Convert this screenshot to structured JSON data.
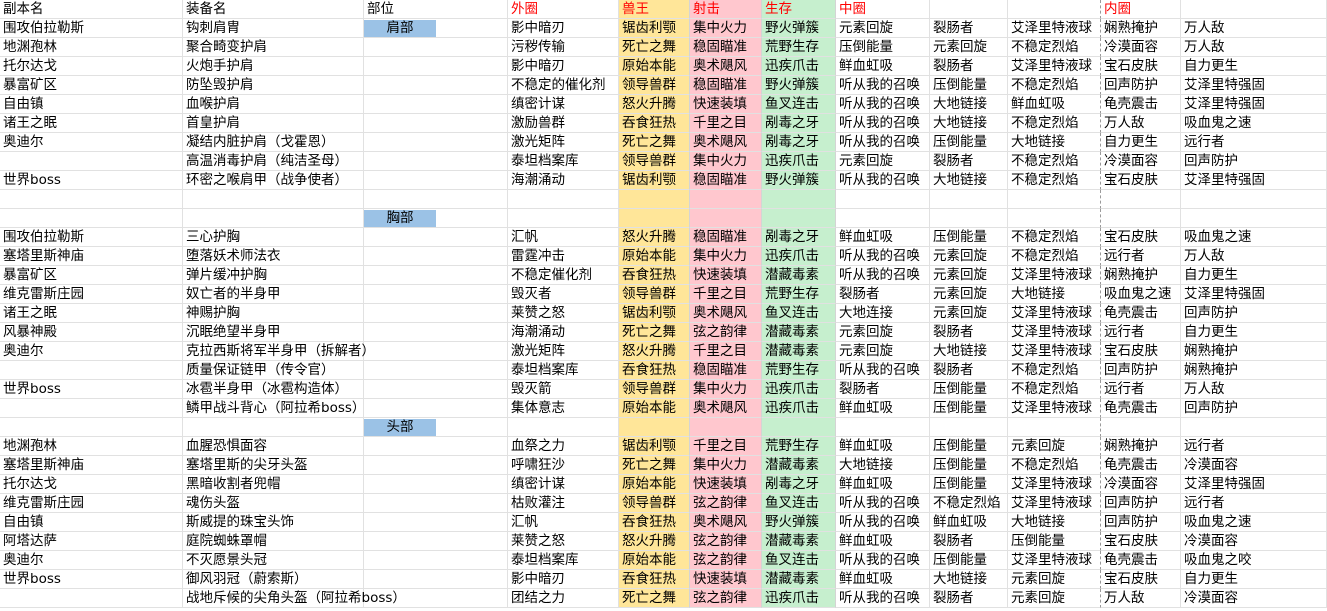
{
  "header": {
    "dungeon": "副本名",
    "equipment": "装备名",
    "slot": "部位",
    "outer": "外圈",
    "beast": "兽王",
    "marks": "射击",
    "survival": "生存",
    "middle": "中圈",
    "inner": "内圈"
  },
  "section_colors": {
    "beast": "#ffe699",
    "marks": "#ffc7ce",
    "survival": "#c6efce",
    "slot_label": "#9bc2e6",
    "header_red": "#ff0000"
  },
  "rows": [
    {
      "cells": [
        "围攻伯拉勒斯",
        "钩刺肩胄",
        "肩部",
        "影中暗刃",
        "锯齿利颚",
        "集中火力",
        "野火弹簇",
        "元素回旋",
        "裂肠者",
        "艾泽里特液球",
        "娴熟掩护",
        "万人敌"
      ]
    },
    {
      "cells": [
        "地渊孢林",
        "聚合畸变护肩",
        "",
        "污秽传输",
        "死亡之舞",
        "稳固瞄准",
        "荒野生存",
        "压倒能量",
        "元素回旋",
        "不稳定烈焰",
        "冷漠面容",
        "万人敌"
      ]
    },
    {
      "cells": [
        "托尔达戈",
        "火炮手护肩",
        "",
        "影中暗刃",
        "原始本能",
        "奥术飓风",
        "迅疾爪击",
        "鲜血虹吸",
        "裂肠者",
        "艾泽里特液球",
        "宝石皮肤",
        "自力更生"
      ]
    },
    {
      "cells": [
        "暴富矿区",
        "防坠毁护肩",
        "",
        "不稳定的催化剂",
        "领导兽群",
        "稳固瞄准",
        "野火弹簇",
        "听从我的召唤",
        "压倒能量",
        "不稳定烈焰",
        "回声防护",
        "艾泽里特强固"
      ]
    },
    {
      "cells": [
        "自由镇",
        "血喉护肩",
        "",
        "缜密计谋",
        "怒火升腾",
        "快速装填",
        "鱼叉连击",
        "听从我的召唤",
        "大地链接",
        "鲜血虹吸",
        "龟壳震击",
        "艾泽里特强固"
      ]
    },
    {
      "cells": [
        "诸王之眠",
        "首皇护肩",
        "",
        "激励兽群",
        "吞食狂热",
        "千里之目",
        "剐毒之牙",
        "听从我的召唤",
        "大地链接",
        "不稳定烈焰",
        "万人敌",
        "吸血鬼之速"
      ]
    },
    {
      "cells": [
        "奥迪尔",
        "凝结内脏护肩（戈霍恩）",
        "",
        "激光矩阵",
        "死亡之舞",
        "奥术飓风",
        "剐毒之牙",
        "听从我的召唤",
        "压倒能量",
        "大地链接",
        "自力更生",
        "远行者"
      ]
    },
    {
      "cells": [
        "",
        "高温消毒护肩（纯洁圣母）",
        "",
        "泰坦档案库",
        "领导兽群",
        "集中火力",
        "迅疾爪击",
        "元素回旋",
        "裂肠者",
        "不稳定烈焰",
        "冷漠面容",
        "回声防护"
      ]
    },
    {
      "cells": [
        "世界boss",
        "环密之喉肩甲（战争使者）",
        "",
        "海潮涌动",
        "锯齿利颚",
        "稳固瞄准",
        "野火弹簇",
        "听从我的召唤",
        "大地链接",
        "不稳定烈焰",
        "宝石皮肤",
        "艾泽里特强固"
      ]
    },
    {
      "cells": [
        "",
        "",
        "",
        "",
        "",
        "",
        "",
        "",
        "",
        "",
        "",
        ""
      ]
    },
    {
      "cells": [
        "",
        "",
        "胸部",
        "",
        "",
        "",
        "",
        "",
        "",
        "",
        "",
        ""
      ]
    },
    {
      "cells": [
        "围攻伯拉勒斯",
        "三心护胸",
        "",
        "汇帆",
        "怒火升腾",
        "稳固瞄准",
        "剐毒之牙",
        "鲜血虹吸",
        "压倒能量",
        "不稳定烈焰",
        "宝石皮肤",
        "吸血鬼之速"
      ]
    },
    {
      "cells": [
        "塞塔里斯神庙",
        "堕落妖术师法衣",
        "",
        "雷霆冲击",
        "原始本能",
        "集中火力",
        "迅疾爪击",
        "听从我的召唤",
        "元素回旋",
        "不稳定烈焰",
        "远行者",
        "万人敌"
      ]
    },
    {
      "cells": [
        "暴富矿区",
        "弹片缓冲护胸",
        "",
        "不稳定催化剂",
        "吞食狂热",
        "快速装填",
        "潜藏毒素",
        "听从我的召唤",
        "元素回旋",
        "艾泽里特液球",
        "娴熟掩护",
        "自力更生"
      ]
    },
    {
      "cells": [
        "维克雷斯庄园",
        "奴亡者的半身甲",
        "",
        "毁灭者",
        "领导兽群",
        "千里之目",
        "荒野生存",
        "裂肠者",
        "元素回旋",
        "大地链接",
        "吸血鬼之速",
        "艾泽里特强固"
      ]
    },
    {
      "cells": [
        "诸王之眠",
        "神赐护胸",
        "",
        "莱赞之怒",
        "锯齿利颚",
        "奥术飓风",
        "鱼叉连击",
        "大地连接",
        "元素回旋",
        "艾泽里特液球",
        "龟壳震击",
        "回声防护"
      ]
    },
    {
      "cells": [
        "风暴神殿",
        "沉眠绝望半身甲",
        "",
        "海潮涌动",
        "死亡之舞",
        "弦之韵律",
        "潜藏毒素",
        "元素回旋",
        "裂肠者",
        "艾泽里特液球",
        "远行者",
        "自力更生"
      ]
    },
    {
      "cells": [
        "奥迪尔",
        "克拉西斯将军半身甲（拆解者）",
        "",
        "激光矩阵",
        "怒火升腾",
        "千里之目",
        "潜藏毒素",
        "元素回旋",
        "大地链接",
        "艾泽里特液球",
        "宝石皮肤",
        "娴熟掩护"
      ]
    },
    {
      "cells": [
        "",
        "质量保证链甲（传令官）",
        "",
        "泰坦档案库",
        "吞食狂热",
        "稳固瞄准",
        "荒野生存",
        "听从我的召唤",
        "裂肠者",
        "不稳定烈焰",
        "回声防护",
        "娴熟掩护"
      ]
    },
    {
      "cells": [
        "世界boss",
        "冰雹半身甲（冰雹构造体）",
        "",
        "毁灭箭",
        "领导兽群",
        "集中火力",
        "迅疾爪击",
        "裂肠者",
        "压倒能量",
        "不稳定烈焰",
        "远行者",
        "万人敌"
      ]
    },
    {
      "cells": [
        "",
        "鳞甲战斗背心（阿拉希boss）",
        "",
        "集体意志",
        "原始本能",
        "奥术飓风",
        "迅疾爪击",
        "鲜血虹吸",
        "压倒能量",
        "艾泽里特液球",
        "龟壳震击",
        "回声防护"
      ]
    },
    {
      "cells": [
        "",
        "",
        "头部",
        "",
        "",
        "",
        "",
        "",
        "",
        "",
        "",
        ""
      ]
    },
    {
      "cells": [
        "地渊孢林",
        "血腥恐惧面容",
        "",
        "血祭之力",
        "锯齿利颚",
        "千里之目",
        "荒野生存",
        "鲜血虹吸",
        "压倒能量",
        "元素回旋",
        "娴熟掩护",
        "远行者"
      ]
    },
    {
      "cells": [
        "塞塔里斯神庙",
        "塞塔里斯的尖牙头盔",
        "",
        "呼啸狂沙",
        "死亡之舞",
        "集中火力",
        "潜藏毒素",
        "大地链接",
        "压倒能量",
        "不稳定烈焰",
        "龟壳震击",
        "冷漠面容"
      ]
    },
    {
      "cells": [
        "托尔达戈",
        "黑暗收割者兜帽",
        "",
        "缜密计谋",
        "原始本能",
        "快速装填",
        "剐毒之牙",
        "鲜血虹吸",
        "压倒能量",
        "艾泽里特液球",
        "冷漠面容",
        "艾泽里特强固"
      ]
    },
    {
      "cells": [
        "维克雷斯庄园",
        "魂伤头盔",
        "",
        "枯败灌注",
        "领导兽群",
        "弦之韵律",
        "鱼叉连击",
        "听从我的召唤",
        "不稳定烈焰",
        "艾泽里特液球",
        "回声防护",
        "远行者"
      ]
    },
    {
      "cells": [
        "自由镇",
        "斯威提的珠宝头饰",
        "",
        "汇帆",
        "吞食狂热",
        "奥术飓风",
        "野火弹簇",
        "听从我的召唤",
        "鲜血虹吸",
        "大地链接",
        "回声防护",
        "吸血鬼之速"
      ]
    },
    {
      "cells": [
        "阿塔达萨",
        "庭院蜘蛛罩帽",
        "",
        "莱赞之怒",
        "怒火升腾",
        "弦之韵律",
        "潜藏毒素",
        "鲜血虹吸",
        "裂肠者",
        "压倒能量",
        "宝石皮肤",
        "冷漠面容"
      ]
    },
    {
      "cells": [
        "奥迪尔",
        "不灭愿景头冠",
        "",
        "泰坦档案库",
        "原始本能",
        "弦之韵律",
        "鱼叉连击",
        "听从我的召唤",
        "压倒能量",
        "艾泽里特液球",
        "龟壳震击",
        "吸血鬼之咬"
      ]
    },
    {
      "cells": [
        "世界boss",
        "御风羽冠（蔚索斯）",
        "",
        "影中暗刃",
        "吞食狂热",
        "快速装填",
        "潜藏毒素",
        "鲜血虹吸",
        "大地链接",
        "元素回旋",
        "宝石皮肤",
        "自力更生"
      ]
    },
    {
      "cells": [
        "",
        "战地斥候的尖角头盔（阿拉希boss）",
        "",
        "团结之力",
        "死亡之舞",
        "弦之韵律",
        "迅疾爪击",
        "听从我的召唤",
        "裂肠者",
        "元素回旋",
        "万人敌",
        "冷漠面容"
      ]
    }
  ]
}
